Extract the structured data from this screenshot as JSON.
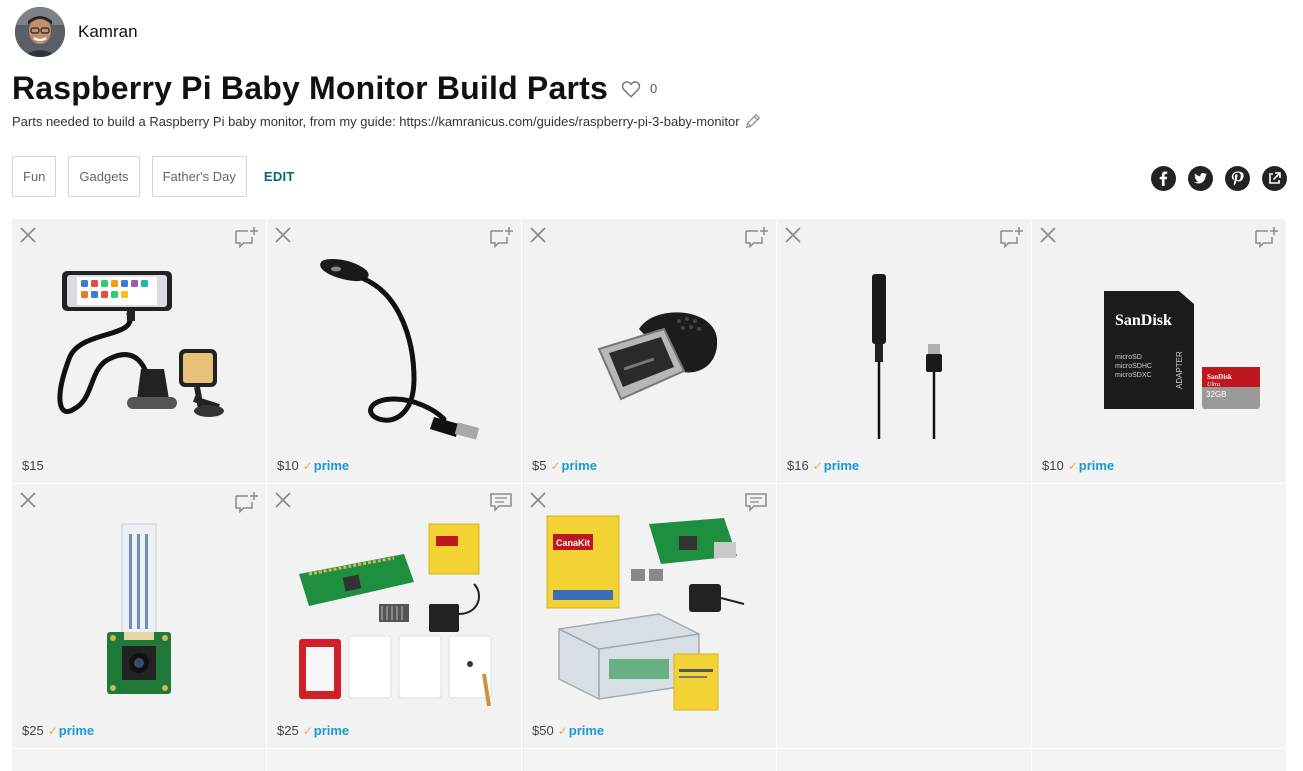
{
  "owner": {
    "name": "Kamran",
    "avatar_icon": "avatar-photo"
  },
  "list": {
    "title": "Raspberry Pi Baby Monitor Build Parts",
    "like_count": "0",
    "description": "Parts needed to build a Raspberry Pi baby monitor, from my guide: https://kamranicus.com/guides/raspberry-pi-3-baby-monitor"
  },
  "tags": [
    "Fun",
    "Gadgets",
    "Father's Day"
  ],
  "edit_label": "EDIT",
  "share": [
    "facebook-icon",
    "twitter-icon",
    "pinterest-icon",
    "external-share-icon"
  ],
  "prime_label": "prime",
  "colors": {
    "prime_blue": "#1a98d5",
    "prime_check": "#f3a847",
    "edit_teal": "#00677a",
    "card_bg": "#f2f2f2"
  },
  "items": [
    {
      "price": "$15",
      "prime": false,
      "icon": "phone-gooseneck-holder",
      "note_icon": "add-note-icon"
    },
    {
      "price": "$10",
      "prime": true,
      "icon": "usb-led-lamp",
      "note_icon": "add-note-icon"
    },
    {
      "price": "$5",
      "prime": true,
      "icon": "usb-microphone-dongle",
      "note_icon": "add-note-icon"
    },
    {
      "price": "$16",
      "prime": true,
      "icon": "usb-clip-microphone",
      "note_icon": "add-note-icon"
    },
    {
      "price": "$10",
      "prime": true,
      "icon": "sandisk-microsd-card",
      "note_icon": "add-note-icon"
    },
    {
      "price": "$25",
      "prime": true,
      "icon": "pi-camera-module",
      "note_icon": "add-note-icon"
    },
    {
      "price": "$25",
      "prime": true,
      "icon": "pi-zero-kit",
      "note_icon": "comment-icon"
    },
    {
      "price": "$50",
      "prime": true,
      "icon": "canakit-pi3-kit",
      "note_icon": "comment-icon"
    }
  ],
  "sandisk": {
    "brand": "SanDisk",
    "line1": "microSD",
    "line2": "microSDHC",
    "line3": "microSDXC",
    "adapter": "ADAPTER",
    "card_brand": "SanDisk",
    "card_ultra": "Ultra",
    "card_size": "32GB"
  },
  "canakit": {
    "brand": "CanaKit"
  }
}
